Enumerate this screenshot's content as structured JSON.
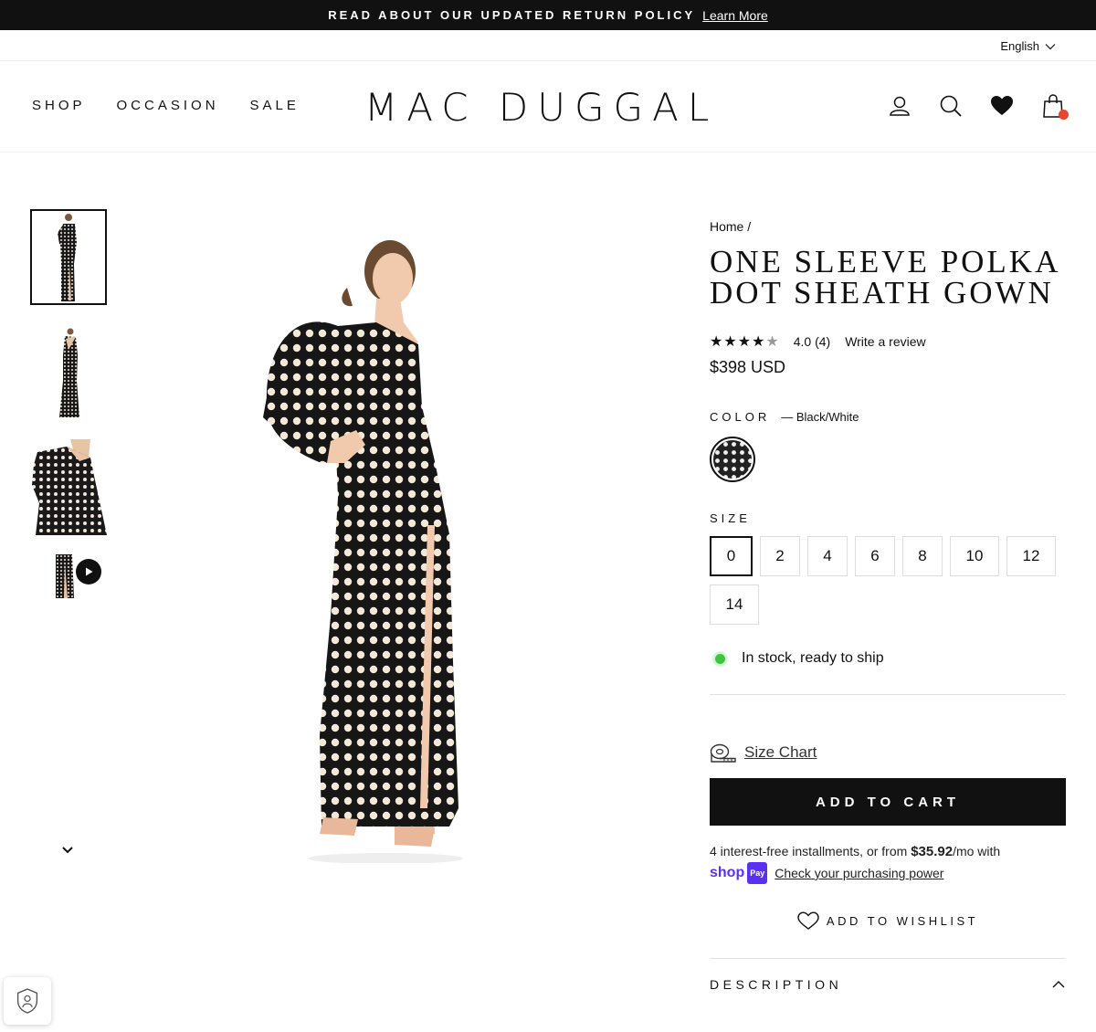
{
  "announcement": {
    "text": "READ ABOUT OUR UPDATED RETURN POLICY",
    "link": "Learn More"
  },
  "language": "English",
  "nav": [
    "SHOP",
    "OCCASION",
    "SALE"
  ],
  "brand": "MAC DUGGAL",
  "header_icons": [
    "account-icon",
    "search-icon",
    "wishlist-heart-icon",
    "cart-icon"
  ],
  "breadcrumb": {
    "home": "Home",
    "sep": "/"
  },
  "product": {
    "title_line1": "ONE SLEEVE POLKA",
    "title_line2": "DOT SHEATH GOWN",
    "stars": "★★★★★",
    "rating_value": 4.0,
    "rating_text": "4.0 (4)",
    "review_link": "Write a review",
    "price": "$398 USD",
    "color_label": "COLOR",
    "color_value": "— Black/White",
    "size_label": "SIZE",
    "sizes": [
      "0",
      "2",
      "4",
      "6",
      "8",
      "10",
      "12",
      "14"
    ],
    "selected_size": "0",
    "stock": "In stock, ready to ship",
    "size_chart": "Size Chart",
    "add_to_cart": "ADD TO CART",
    "installments_pre": "4 interest-free installments, or from ",
    "installments_amount": "$35.92",
    "installments_post": "/mo with",
    "shop_text": "shop",
    "pay_text": "Pay",
    "purchasing_power": "Check your purchasing power",
    "wishlist": "ADD TO WISHLIST",
    "description": "DESCRIPTION"
  },
  "colors": {
    "accent": "#111111",
    "cart_dot": "#e8462b",
    "shop_pay": "#5a31f4",
    "in_stock": "#3fc43f"
  }
}
